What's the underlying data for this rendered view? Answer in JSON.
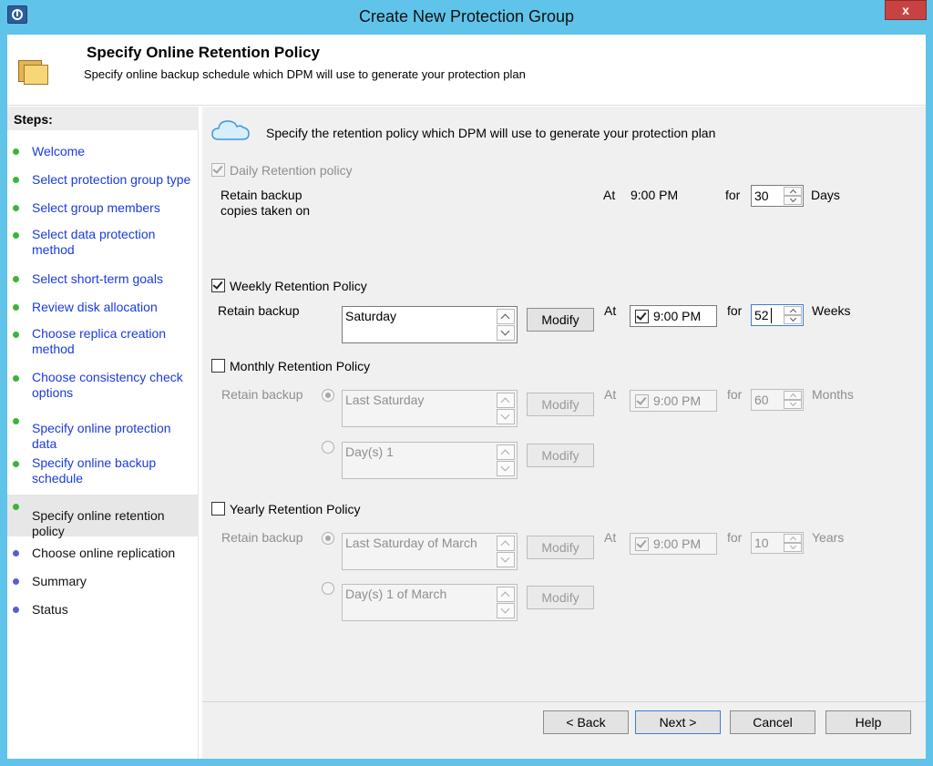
{
  "window": {
    "title": "Create New Protection Group",
    "close": "x"
  },
  "header": {
    "title": "Specify Online Retention Policy",
    "subtitle": "Specify online backup schedule which DPM will use to generate your protection plan"
  },
  "sidebar": {
    "heading": "Steps:",
    "steps": [
      {
        "label": "Welcome"
      },
      {
        "label": "Select protection group type"
      },
      {
        "label": "Select group members"
      },
      {
        "label": "Select data protection method"
      },
      {
        "label": "Select short-term goals"
      },
      {
        "label": "Review disk allocation"
      },
      {
        "label": "Choose replica creation method"
      },
      {
        "label": "Choose consistency check options"
      },
      {
        "label": "Specify online protection data"
      },
      {
        "label": "Specify online backup schedule"
      },
      {
        "label": "Specify online retention policy"
      },
      {
        "label": "Choose online replication"
      },
      {
        "label": "Summary"
      },
      {
        "label": "Status"
      }
    ]
  },
  "main": {
    "intro": "Specify the retention policy which DPM will use to generate your protection plan",
    "daily": {
      "label": "Daily Retention policy",
      "retain_text": "Retain backup copies taken on",
      "at": "At",
      "time": "9:00 PM",
      "for": "for",
      "count": "30",
      "unit": "Days"
    },
    "weekly": {
      "label": "Weekly Retention Policy",
      "retain_text": "Retain backup",
      "day": "Saturday",
      "modify": "Modify",
      "at": "At",
      "time": "9:00 PM",
      "for": "for",
      "count": "52",
      "unit": "Weeks"
    },
    "monthly": {
      "label": "Monthly Retention Policy",
      "retain_text": "Retain backup",
      "option1": "Last Saturday",
      "option2": "Day(s) 1",
      "modify": "Modify",
      "at": "At",
      "time": "9:00 PM",
      "for": "for",
      "count": "60",
      "unit": "Months"
    },
    "yearly": {
      "label": "Yearly Retention Policy",
      "retain_text": "Retain backup",
      "option1": "Last Saturday of March",
      "option2": "Day(s) 1 of March",
      "modify": "Modify",
      "at": "At",
      "time": "9:00 PM",
      "for": "for",
      "count": "10",
      "unit": "Years"
    }
  },
  "buttons": {
    "back": "< Back",
    "next": "Next >",
    "cancel": "Cancel",
    "help": "Help"
  }
}
